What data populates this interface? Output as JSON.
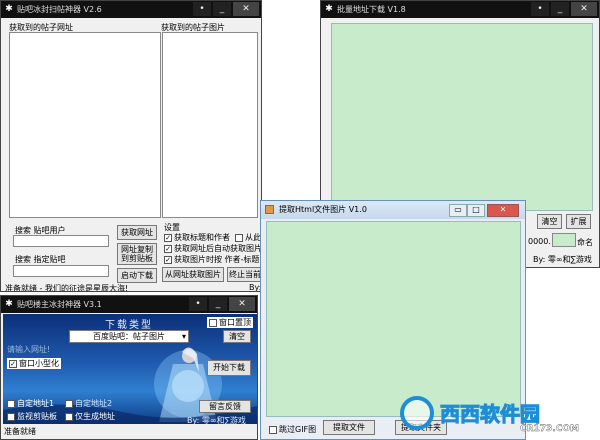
{
  "win1": {
    "title": "贴吧冰封扫帖神器 V2.6",
    "col_urls": "获取到的帖子网址",
    "col_images": "获取到的帖子图片",
    "search_user_label": "搜索 贴吧用户",
    "search_bar_label": "搜索 指定贴吧",
    "btn_get_url": "获取网址",
    "btn_copy_url": "网址复制到剪贴板",
    "btn_start_download": "启动下载",
    "btn_from_url_get_image": "从网址获取图片",
    "btn_stop": "终止当前",
    "settings_label": "设置",
    "cb_title_author": "获取标题和作者",
    "cb_from_this": "从此",
    "cb_auto_image": "获取网址后自动获取图片",
    "cb_image_time": "获取图片时按 作者-标题",
    "status": "准备就绪 - 我们的征途是星辰大海!",
    "by": "By:"
  },
  "win2": {
    "title": "批量地址下载 V1.8",
    "btn_clear": "清空",
    "btn_expand": "扩展",
    "counter": "0000.",
    "rename": "命名",
    "by": "By: 零∞和∑游戏"
  },
  "win3": {
    "title": "贴吧楼主冰封神器 V3.1",
    "banner": "下载类型",
    "chk_pin": "窗口置顶",
    "select_value": "百度贴吧：帖子图片",
    "btn_clear": "清空",
    "input_placeholder": "请输入网址!",
    "chk_mini": "窗口小型化",
    "btn_start": "开始下载",
    "chk_custom1": "自定地址1",
    "chk_custom2": "自定地址2",
    "chk_monitor": "监视剪贴板",
    "chk_only_gen": "仅生成地址",
    "btn_feedback": "留言反馈",
    "by": "By: 零∞和∑游戏",
    "status": "准备就绪"
  },
  "win4": {
    "title": "提取Html文件图片 V1.0",
    "chk_skip_gif": "跳过GIF图",
    "btn_extract": "提取文件",
    "btn_other": "提取文件夹"
  },
  "watermark": {
    "brand": "西西软件园",
    "url": "CR173.COM"
  }
}
